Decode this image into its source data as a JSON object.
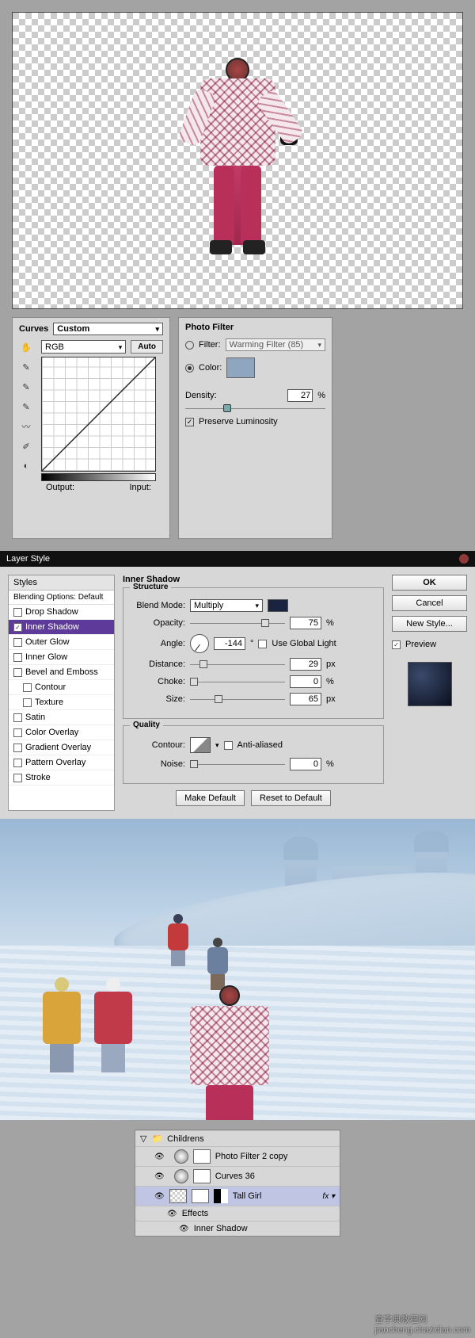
{
  "curves": {
    "title": "Curves",
    "preset": "Custom",
    "channel": "RGB",
    "auto": "Auto",
    "output": "Output:",
    "input": "Input:"
  },
  "photo_filter": {
    "title": "Photo Filter",
    "filter_label": "Filter:",
    "filter_value": "Warming Filter (85)",
    "color_label": "Color:",
    "color": "#8fa6c0",
    "density_label": "Density:",
    "density_value": "27",
    "density_unit": "%",
    "preserve": "Preserve Luminosity"
  },
  "layer_style": {
    "title": "Layer Style",
    "styles_header": "Styles",
    "blending_options": "Blending Options: Default",
    "items": [
      {
        "label": "Drop Shadow",
        "checked": false
      },
      {
        "label": "Inner Shadow",
        "checked": true,
        "selected": true
      },
      {
        "label": "Outer Glow",
        "checked": false
      },
      {
        "label": "Inner Glow",
        "checked": false
      },
      {
        "label": "Bevel and Emboss",
        "checked": false
      },
      {
        "label": "Contour",
        "checked": false,
        "indent": true
      },
      {
        "label": "Texture",
        "checked": false,
        "indent": true
      },
      {
        "label": "Satin",
        "checked": false
      },
      {
        "label": "Color Overlay",
        "checked": false
      },
      {
        "label": "Gradient Overlay",
        "checked": false
      },
      {
        "label": "Pattern Overlay",
        "checked": false
      },
      {
        "label": "Stroke",
        "checked": false
      }
    ],
    "section_title": "Inner Shadow",
    "structure": {
      "legend": "Structure",
      "blend_mode_label": "Blend Mode:",
      "blend_mode": "Multiply",
      "blend_color": "#1a2340",
      "opacity_label": "Opacity:",
      "opacity_value": "75",
      "pct": "%",
      "angle_label": "Angle:",
      "angle_value": "-144",
      "angle_deg": "°",
      "use_global": "Use Global Light",
      "distance_label": "Distance:",
      "distance_value": "29",
      "px": "px",
      "choke_label": "Choke:",
      "choke_value": "0",
      "size_label": "Size:",
      "size_value": "65"
    },
    "quality": {
      "legend": "Quality",
      "contour_label": "Contour:",
      "anti_aliased": "Anti-aliased",
      "noise_label": "Noise:",
      "noise_value": "0"
    },
    "make_default": "Make Default",
    "reset_default": "Reset to Default",
    "ok": "OK",
    "cancel": "Cancel",
    "new_style": "New Style...",
    "preview": "Preview"
  },
  "layers": {
    "group": "Childrens",
    "rows": [
      {
        "name": "Photo Filter 2 copy"
      },
      {
        "name": "Curves 36"
      },
      {
        "name": "Tall Girl",
        "selected": true,
        "fx": "fx"
      }
    ],
    "effects": "Effects",
    "inner_shadow": "Inner Shadow"
  },
  "watermark": {
    "line1": "查字典教程网",
    "line2": "jiaocheng.chazidian.com"
  }
}
